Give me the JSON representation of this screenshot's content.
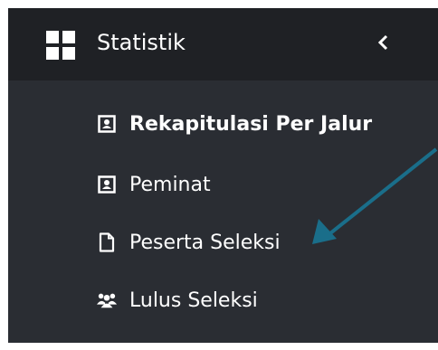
{
  "header": {
    "title": "Statistik",
    "icon": "grid-icon",
    "collapse_icon": "chevron-left-icon"
  },
  "menu": {
    "items": [
      {
        "label": "Rekapitulasi Per Jalur",
        "icon": "contact-card-icon",
        "active": true
      },
      {
        "label": "Peminat",
        "icon": "contact-card-icon",
        "active": false
      },
      {
        "label": "Peserta Seleksi",
        "icon": "document-icon",
        "active": false
      },
      {
        "label": "Lulus Seleksi",
        "icon": "users-icon",
        "active": false
      }
    ]
  },
  "annotation": {
    "icon": "arrow-icon",
    "color": "#1a6e8a"
  },
  "colors": {
    "sidebar_bg": "#2a2d33",
    "header_bg": "#1f2125",
    "text": "#ffffff"
  }
}
